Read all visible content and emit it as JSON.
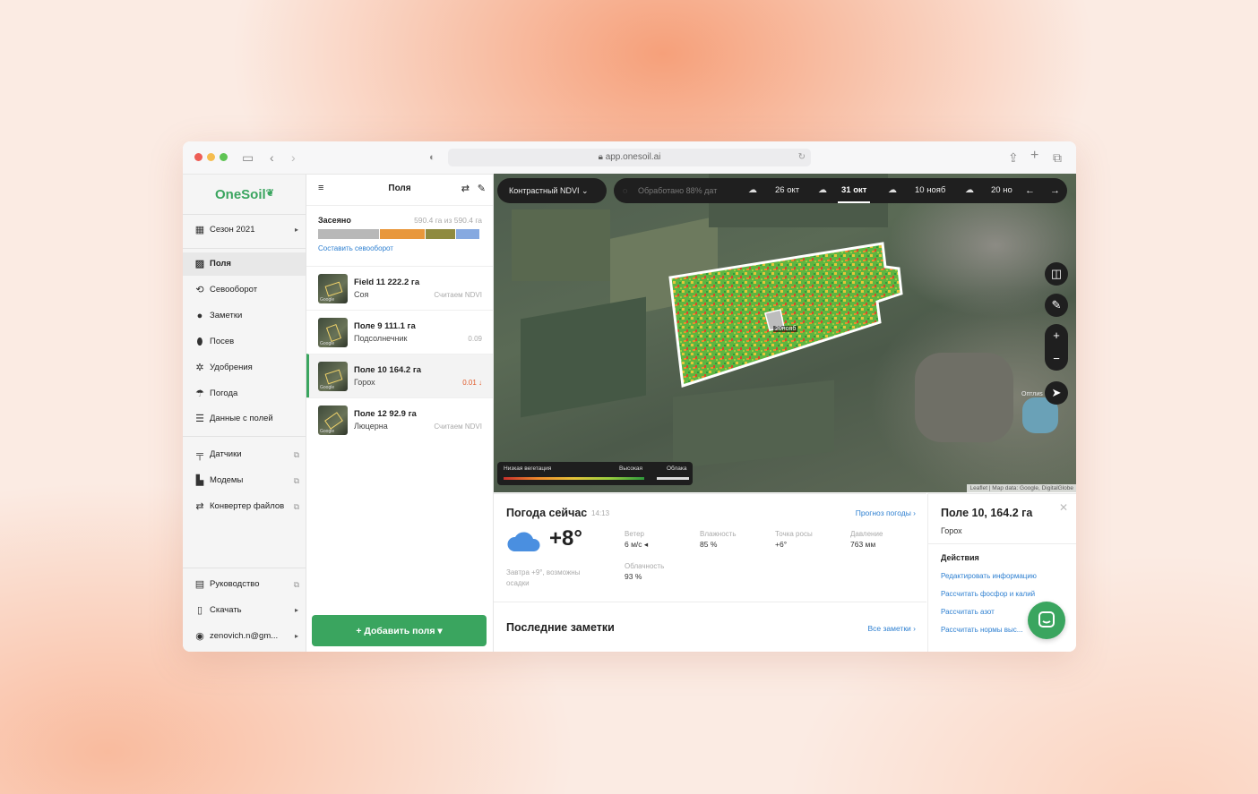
{
  "browser": {
    "url": "app.onesoil.ai"
  },
  "nav": {
    "logo": "OneSoil",
    "season": "Сезон 2021",
    "items": [
      "Поля",
      "Севооборот",
      "Заметки",
      "Посев",
      "Удобрения",
      "Погода",
      "Данные с полей"
    ],
    "tools": [
      "Датчики",
      "Модемы",
      "Конвертер файлов"
    ],
    "bottom": [
      "Руководство",
      "Скачать",
      "zenovich.n@gm..."
    ]
  },
  "fields_panel": {
    "title": "Поля",
    "sown_label": "Засеяно",
    "sown_value": "590.4 га из 590.4 га",
    "bar_colors": [
      "#b8b8b8",
      "#e8973b",
      "#8f8a3f",
      "#86a9e0"
    ],
    "bar_shares": [
      0.38,
      0.28,
      0.19,
      0.15
    ],
    "rotation_link": "Составить севооборот",
    "google_tag": "Google",
    "fields": [
      {
        "name": "Field 11 222.2 га",
        "crop": "Соя",
        "value": "Считаем NDVI",
        "active": false
      },
      {
        "name": "Поле 9 111.1 га",
        "crop": "Подсолнечник",
        "value": "0.09",
        "active": false
      },
      {
        "name": "Поле 10 164.2 га",
        "crop": "Горох",
        "value": "0.01 ↓",
        "active": true
      },
      {
        "name": "Поле 12 92.9 га",
        "crop": "Люцерна",
        "value": "Считаем NDVI",
        "active": false
      }
    ],
    "add_button": "+ Добавить поля ▾"
  },
  "map": {
    "layer_select": "Контрастный NDVI ⌄",
    "processing": "Обработано 88% дат",
    "dates": [
      "26 окт",
      "31 окт",
      "10 нояб",
      "20 но"
    ],
    "selected_date": "31 окт",
    "field_label": "20нояб",
    "place_label": "Оптлиs",
    "legend": {
      "low": "Низкая вегетация",
      "high": "Высокая",
      "clouds": "Облака"
    },
    "attribution": "Leaflet | Map data: Google, DigitalGlobe"
  },
  "weather": {
    "title": "Погода сейчас",
    "time": "14:13",
    "forecast_link": "Прогноз погоды ›",
    "temperature": "+8°",
    "tomorrow": "Завтра +9°, возможны осадки",
    "stats": [
      {
        "label": "Ветер",
        "value": "6 м/с ◂"
      },
      {
        "label": "Влажность",
        "value": "85 %"
      },
      {
        "label": "Точка росы",
        "value": "+6°"
      },
      {
        "label": "Давление",
        "value": "763 мм"
      },
      {
        "label": "Облачность",
        "value": "93 %"
      }
    ]
  },
  "notes": {
    "title": "Последние заметки",
    "link": "Все заметки ›"
  },
  "field_info": {
    "title": "Поле 10, 164.2 га",
    "crop": "Горох",
    "actions_label": "Действия",
    "actions": [
      "Редактировать информацию",
      "Рассчитать фосфор и калий",
      "Рассчитать азот",
      "Рассчитать нормы выс..."
    ]
  }
}
